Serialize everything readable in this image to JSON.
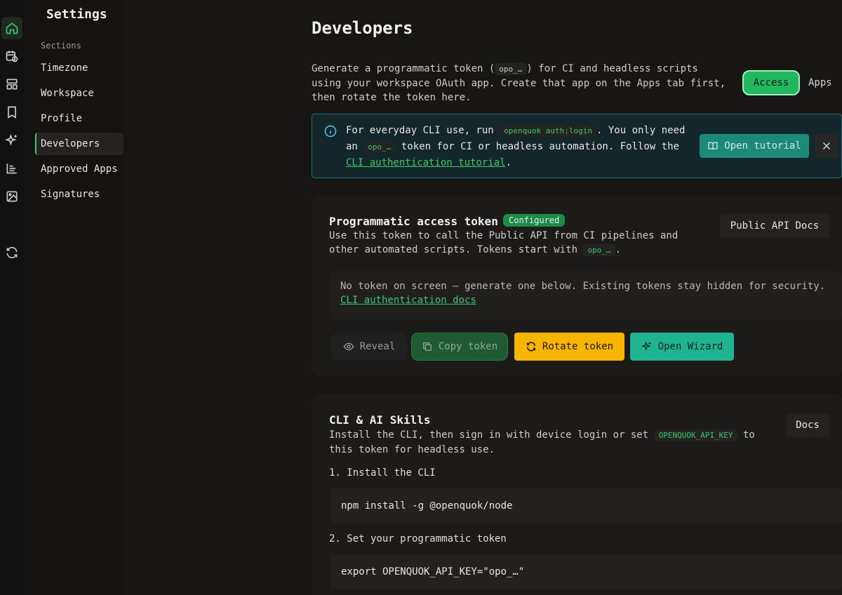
{
  "sidebar": {
    "title": "Settings",
    "section_label": "Sections",
    "items": [
      {
        "label": "Timezone"
      },
      {
        "label": "Workspace"
      },
      {
        "label": "Profile"
      },
      {
        "label": "Developers"
      },
      {
        "label": "Approved Apps"
      },
      {
        "label": "Signatures"
      }
    ]
  },
  "main": {
    "title": "Developers",
    "intro": {
      "before": "Generate a programmatic token (",
      "code": "opo_…",
      "after": ") for CI and headless scripts using your workspace OAuth app. Create that app on the Apps tab first, then rotate the token here."
    },
    "tabs": {
      "access": "Access",
      "apps": "Apps"
    },
    "info": {
      "part1": "For everyday CLI use, run ",
      "code1": "openquok auth:login",
      "part2": ". You only need an ",
      "code2": "opo_…",
      "part3": " token for CI or headless automation. Follow the ",
      "link": "CLI authentication tutorial",
      "part4": ".",
      "button": "Open tutorial"
    },
    "token_card": {
      "title": "Programmatic access token",
      "badge": "Configured",
      "desc": "Use this token to call the Public API from CI pipelines and other automated scripts. Tokens start with ",
      "desc_code": "opo_…",
      "desc_end": ".",
      "docs_button": "Public API Docs",
      "notice": "No token on screen — generate one below. Existing tokens stay hidden for security. ",
      "notice_link": "CLI authentication docs",
      "buttons": {
        "reveal": "Reveal",
        "copy": "Copy token",
        "rotate": "Rotate token",
        "wizard": "Open Wizard"
      }
    },
    "cli_card": {
      "title": "CLI & AI Skills",
      "desc_before": "Install the CLI, then sign in with device login or set ",
      "desc_code": "OPENQUOK_API_KEY",
      "desc_after": " to this token for headless use.",
      "docs_button": "Docs",
      "steps": [
        {
          "label": "1. Install the CLI",
          "command": "npm install -g @openquok/node"
        },
        {
          "label": "2. Set your programmatic token",
          "command": "export OPENQUOK_API_KEY=\"opo_…\""
        }
      ]
    }
  },
  "colors": {
    "accent": "#3fc66b",
    "warning": "#f7b500",
    "teal": "#1fb390"
  }
}
